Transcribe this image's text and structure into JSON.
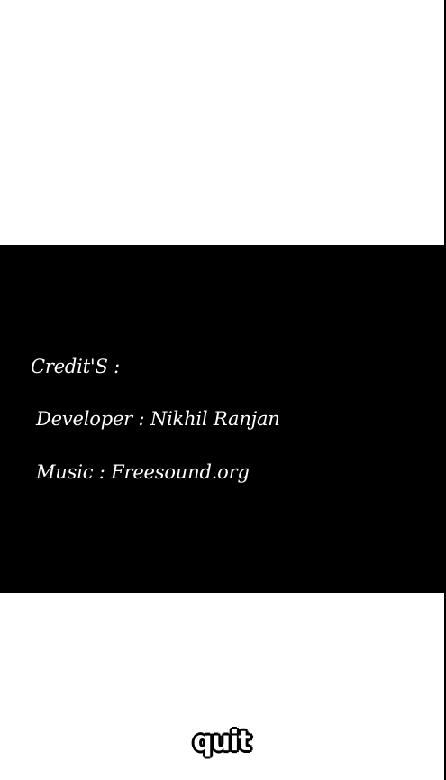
{
  "credits": {
    "heading": "Credit'S :",
    "developer": "Developer : Nikhil Ranjan",
    "music": "Music : Freesound.org"
  },
  "actions": {
    "quit_label": "quit"
  },
  "colors": {
    "background": "#ffffff",
    "panel": "#000000",
    "text": "#ffffff"
  }
}
